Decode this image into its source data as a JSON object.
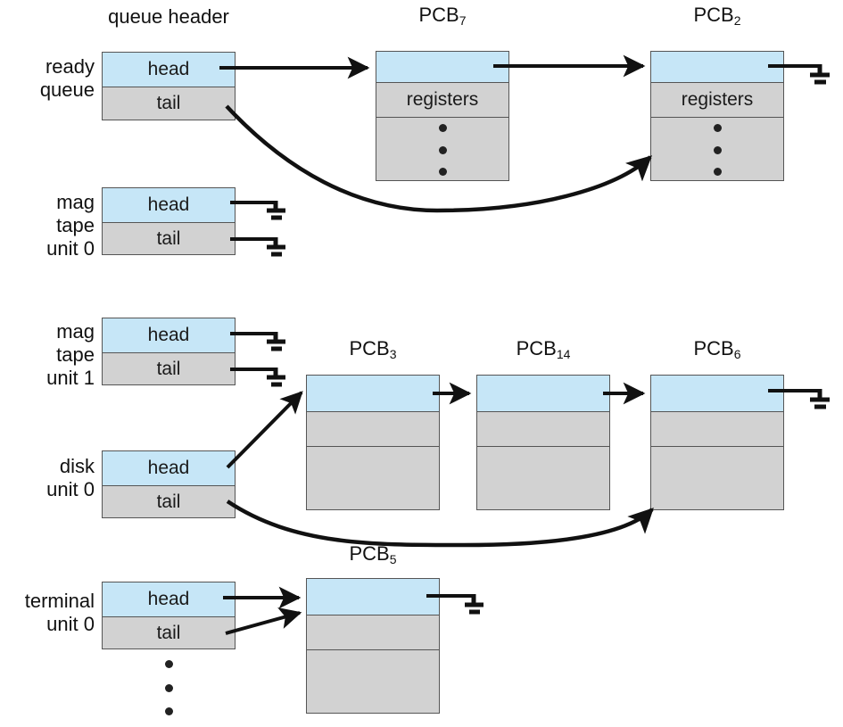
{
  "diagram": {
    "title_visible": false,
    "colors": {
      "header_fill": "#c6e6f7",
      "body_fill": "#d2d2d2",
      "border": "#555555",
      "line": "#111111",
      "background": "#ffffff"
    }
  },
  "headers": {
    "queue_header": "queue header",
    "pcb7": "PCB",
    "pcb7_sub": "7",
    "pcb2": "PCB",
    "pcb2_sub": "2",
    "pcb3": "PCB",
    "pcb3_sub": "3",
    "pcb14": "PCB",
    "pcb14_sub": "14",
    "pcb6": "PCB",
    "pcb6_sub": "6",
    "pcb5": "PCB",
    "pcb5_sub": "5"
  },
  "queues": [
    {
      "id": "ready-queue",
      "label": "ready\nqueue",
      "label_line1": "ready",
      "label_line2": "queue",
      "head_label": "head",
      "tail_label": "tail",
      "head_target": "PCB7",
      "tail_target": "PCB2"
    },
    {
      "id": "mag-tape-unit-0",
      "label_line1": "mag",
      "label_line2": "tape",
      "label_line3": "unit 0",
      "head_label": "head",
      "tail_label": "tail",
      "head_target": "null",
      "tail_target": "null"
    },
    {
      "id": "mag-tape-unit-1",
      "label_line1": "mag",
      "label_line2": "tape",
      "label_line3": "unit 1",
      "head_label": "head",
      "tail_label": "tail",
      "head_target": "null",
      "tail_target": "null"
    },
    {
      "id": "disk-unit-0",
      "label_line1": "disk",
      "label_line2": "unit 0",
      "head_label": "head",
      "tail_label": "tail",
      "head_target": "PCB3",
      "tail_target": "PCB6"
    },
    {
      "id": "terminal-unit-0",
      "label_line1": "terminal",
      "label_line2": "unit 0",
      "head_label": "head",
      "tail_label": "tail",
      "head_target": "PCB5",
      "tail_target": "PCB5"
    }
  ],
  "pcbs": [
    {
      "id": "pcb7",
      "name": "PCB",
      "index": "7",
      "section2_label": "registers",
      "dots": 3,
      "next": "PCB2"
    },
    {
      "id": "pcb2",
      "name": "PCB",
      "index": "2",
      "section2_label": "registers",
      "dots": 3,
      "next": "null"
    },
    {
      "id": "pcb3",
      "name": "PCB",
      "index": "3",
      "section2_label": "",
      "dots": 0,
      "next": "PCB14"
    },
    {
      "id": "pcb14",
      "name": "PCB",
      "index": "14",
      "section2_label": "",
      "dots": 0,
      "next": "PCB6"
    },
    {
      "id": "pcb6",
      "name": "PCB",
      "index": "6",
      "section2_label": "",
      "dots": 0,
      "next": "null"
    },
    {
      "id": "pcb5",
      "name": "PCB",
      "index": "5",
      "section2_label": "",
      "dots": 0,
      "next": "null"
    }
  ],
  "icons": {
    "ground": "ground-icon",
    "arrow": "arrow-icon",
    "ellipsis": "vertical-ellipsis-icon"
  }
}
